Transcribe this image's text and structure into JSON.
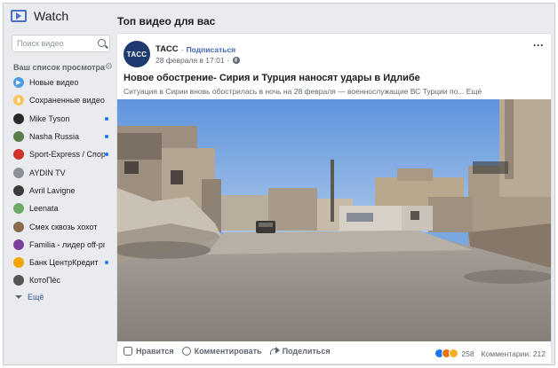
{
  "sidebar": {
    "title": "Watch",
    "search_placeholder": "Поиск видео",
    "watchlist_title": "Ваш список просмотра",
    "items": [
      {
        "label": "Новые видео",
        "icon": "play-circle-icon",
        "color": "#4d9de0",
        "badge": false
      },
      {
        "label": "Сохраненные видео",
        "icon": "bookmark-icon",
        "color": "#ffc35a",
        "badge": false
      },
      {
        "label": "Mike Tyson",
        "icon": "avatar",
        "color": "#2a2a2a",
        "badge": true
      },
      {
        "label": "Nasha Russia",
        "icon": "avatar",
        "color": "#5b7d4a",
        "badge": true
      },
      {
        "label": "Sport-Express / Спорт-Экспресс",
        "icon": "avatar",
        "color": "#d0312d",
        "badge": true
      },
      {
        "label": "AYDIN TV",
        "icon": "avatar",
        "color": "#8a8f98",
        "badge": false
      },
      {
        "label": "Avril Lavigne",
        "icon": "avatar",
        "color": "#3b3b3b",
        "badge": false
      },
      {
        "label": "Leenata",
        "icon": "avatar",
        "color": "#6aaa64",
        "badge": false
      },
      {
        "label": "Смех сквозь хохот",
        "icon": "avatar",
        "color": "#8c6a4f",
        "badge": false
      },
      {
        "label": "Familia - лидер off-price в России",
        "icon": "avatar",
        "color": "#7b3fa0",
        "badge": false
      },
      {
        "label": "Банк ЦентрКредит",
        "icon": "avatar",
        "color": "#f0a500",
        "badge": true
      },
      {
        "label": "КотоПёс",
        "icon": "avatar",
        "color": "#555555",
        "badge": false
      }
    ],
    "more_label": "Ещё"
  },
  "main": {
    "section_title": "Топ видео для вас",
    "post": {
      "page_logo_text": "ТАСС",
      "page_name": "ТАСС",
      "separator": "·",
      "subscribe_label": "Подписаться",
      "timestamp": "28 февраля в 17:01 ·",
      "options_label": "···",
      "title": "Новое обострение- Сирия и Турция наносят удары в Идлибе",
      "description": "Ситуация в Сирии вновь обострилась в ночь на 28 февраля — военнослужащие ВС Турции по...",
      "see_more": "Ещё",
      "actions": {
        "like": "Нравится",
        "comment": "Комментировать",
        "share": "Поделиться"
      },
      "reactions_count": "258",
      "comments_count": "Комментарии: 212"
    }
  },
  "colors": {
    "accent": "#4267b2",
    "background": "#e9ebee",
    "badge": "#1877f2"
  }
}
